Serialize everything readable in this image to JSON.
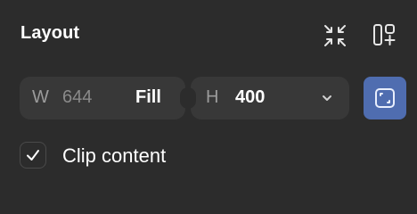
{
  "panel": {
    "title": "Layout"
  },
  "header": {
    "collapse_icon": "collapse-arrows-icon",
    "auto_layout_icon": "auto-layout-add-icon"
  },
  "width_field": {
    "label": "W",
    "value": "644",
    "mode": "Fill"
  },
  "height_field": {
    "label": "H",
    "value": "400",
    "dropdown_icon": "chevron-down-icon"
  },
  "clip_toggle": {
    "icon": "clip-content-icon",
    "active": true,
    "accent": "#4f6db0"
  },
  "clip_content": {
    "label": "Clip content",
    "checked": true
  },
  "colors": {
    "background": "#2c2c2c",
    "field": "#383838",
    "muted_text": "#9b9b9b",
    "accent": "#4f6db0"
  }
}
